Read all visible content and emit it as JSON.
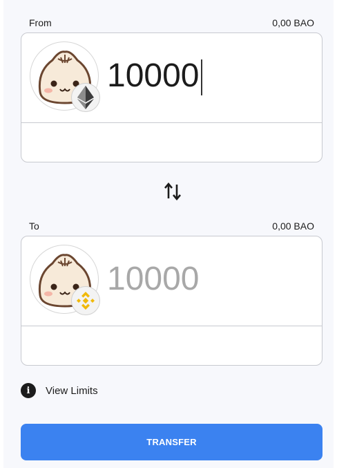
{
  "from": {
    "label": "From",
    "balance": "0,00 BAO",
    "amount": "10000",
    "token_icon": "bao-bun-icon",
    "chain_icon": "ethereum-icon"
  },
  "swap_icon": "swap-arrows-icon",
  "to": {
    "label": "To",
    "balance": "0,00 BAO",
    "amount": "10000",
    "token_icon": "bao-bun-icon",
    "chain_icon": "binance-icon"
  },
  "limits": {
    "label": "View Limits",
    "icon": "info-icon"
  },
  "transfer_label": "TRANSFER",
  "colors": {
    "accent": "#3b82f0",
    "border": "#c7c9cf",
    "binance": "#f0b90b",
    "ethereum": "#3c3c3d"
  }
}
